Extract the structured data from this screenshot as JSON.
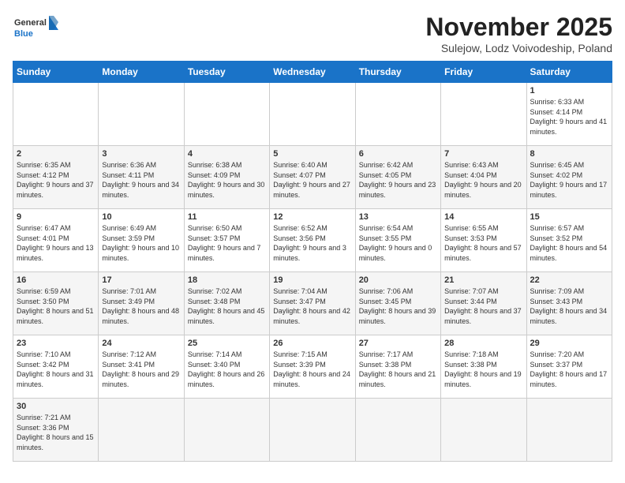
{
  "logo": {
    "text_general": "General",
    "text_blue": "Blue"
  },
  "calendar": {
    "title": "November 2025",
    "subtitle": "Sulejow, Lodz Voivodeship, Poland"
  },
  "weekdays": [
    "Sunday",
    "Monday",
    "Tuesday",
    "Wednesday",
    "Thursday",
    "Friday",
    "Saturday"
  ],
  "weeks": [
    [
      {
        "day": "",
        "info": ""
      },
      {
        "day": "",
        "info": ""
      },
      {
        "day": "",
        "info": ""
      },
      {
        "day": "",
        "info": ""
      },
      {
        "day": "",
        "info": ""
      },
      {
        "day": "",
        "info": ""
      },
      {
        "day": "1",
        "info": "Sunrise: 6:33 AM\nSunset: 4:14 PM\nDaylight: 9 hours and 41 minutes."
      }
    ],
    [
      {
        "day": "2",
        "info": "Sunrise: 6:35 AM\nSunset: 4:12 PM\nDaylight: 9 hours and 37 minutes."
      },
      {
        "day": "3",
        "info": "Sunrise: 6:36 AM\nSunset: 4:11 PM\nDaylight: 9 hours and 34 minutes."
      },
      {
        "day": "4",
        "info": "Sunrise: 6:38 AM\nSunset: 4:09 PM\nDaylight: 9 hours and 30 minutes."
      },
      {
        "day": "5",
        "info": "Sunrise: 6:40 AM\nSunset: 4:07 PM\nDaylight: 9 hours and 27 minutes."
      },
      {
        "day": "6",
        "info": "Sunrise: 6:42 AM\nSunset: 4:05 PM\nDaylight: 9 hours and 23 minutes."
      },
      {
        "day": "7",
        "info": "Sunrise: 6:43 AM\nSunset: 4:04 PM\nDaylight: 9 hours and 20 minutes."
      },
      {
        "day": "8",
        "info": "Sunrise: 6:45 AM\nSunset: 4:02 PM\nDaylight: 9 hours and 17 minutes."
      }
    ],
    [
      {
        "day": "9",
        "info": "Sunrise: 6:47 AM\nSunset: 4:01 PM\nDaylight: 9 hours and 13 minutes."
      },
      {
        "day": "10",
        "info": "Sunrise: 6:49 AM\nSunset: 3:59 PM\nDaylight: 9 hours and 10 minutes."
      },
      {
        "day": "11",
        "info": "Sunrise: 6:50 AM\nSunset: 3:57 PM\nDaylight: 9 hours and 7 minutes."
      },
      {
        "day": "12",
        "info": "Sunrise: 6:52 AM\nSunset: 3:56 PM\nDaylight: 9 hours and 3 minutes."
      },
      {
        "day": "13",
        "info": "Sunrise: 6:54 AM\nSunset: 3:55 PM\nDaylight: 9 hours and 0 minutes."
      },
      {
        "day": "14",
        "info": "Sunrise: 6:55 AM\nSunset: 3:53 PM\nDaylight: 8 hours and 57 minutes."
      },
      {
        "day": "15",
        "info": "Sunrise: 6:57 AM\nSunset: 3:52 PM\nDaylight: 8 hours and 54 minutes."
      }
    ],
    [
      {
        "day": "16",
        "info": "Sunrise: 6:59 AM\nSunset: 3:50 PM\nDaylight: 8 hours and 51 minutes."
      },
      {
        "day": "17",
        "info": "Sunrise: 7:01 AM\nSunset: 3:49 PM\nDaylight: 8 hours and 48 minutes."
      },
      {
        "day": "18",
        "info": "Sunrise: 7:02 AM\nSunset: 3:48 PM\nDaylight: 8 hours and 45 minutes."
      },
      {
        "day": "19",
        "info": "Sunrise: 7:04 AM\nSunset: 3:47 PM\nDaylight: 8 hours and 42 minutes."
      },
      {
        "day": "20",
        "info": "Sunrise: 7:06 AM\nSunset: 3:45 PM\nDaylight: 8 hours and 39 minutes."
      },
      {
        "day": "21",
        "info": "Sunrise: 7:07 AM\nSunset: 3:44 PM\nDaylight: 8 hours and 37 minutes."
      },
      {
        "day": "22",
        "info": "Sunrise: 7:09 AM\nSunset: 3:43 PM\nDaylight: 8 hours and 34 minutes."
      }
    ],
    [
      {
        "day": "23",
        "info": "Sunrise: 7:10 AM\nSunset: 3:42 PM\nDaylight: 8 hours and 31 minutes."
      },
      {
        "day": "24",
        "info": "Sunrise: 7:12 AM\nSunset: 3:41 PM\nDaylight: 8 hours and 29 minutes."
      },
      {
        "day": "25",
        "info": "Sunrise: 7:14 AM\nSunset: 3:40 PM\nDaylight: 8 hours and 26 minutes."
      },
      {
        "day": "26",
        "info": "Sunrise: 7:15 AM\nSunset: 3:39 PM\nDaylight: 8 hours and 24 minutes."
      },
      {
        "day": "27",
        "info": "Sunrise: 7:17 AM\nSunset: 3:38 PM\nDaylight: 8 hours and 21 minutes."
      },
      {
        "day": "28",
        "info": "Sunrise: 7:18 AM\nSunset: 3:38 PM\nDaylight: 8 hours and 19 minutes."
      },
      {
        "day": "29",
        "info": "Sunrise: 7:20 AM\nSunset: 3:37 PM\nDaylight: 8 hours and 17 minutes."
      }
    ],
    [
      {
        "day": "30",
        "info": "Sunrise: 7:21 AM\nSunset: 3:36 PM\nDaylight: 8 hours and 15 minutes."
      },
      {
        "day": "",
        "info": ""
      },
      {
        "day": "",
        "info": ""
      },
      {
        "day": "",
        "info": ""
      },
      {
        "day": "",
        "info": ""
      },
      {
        "day": "",
        "info": ""
      },
      {
        "day": "",
        "info": ""
      }
    ]
  ]
}
